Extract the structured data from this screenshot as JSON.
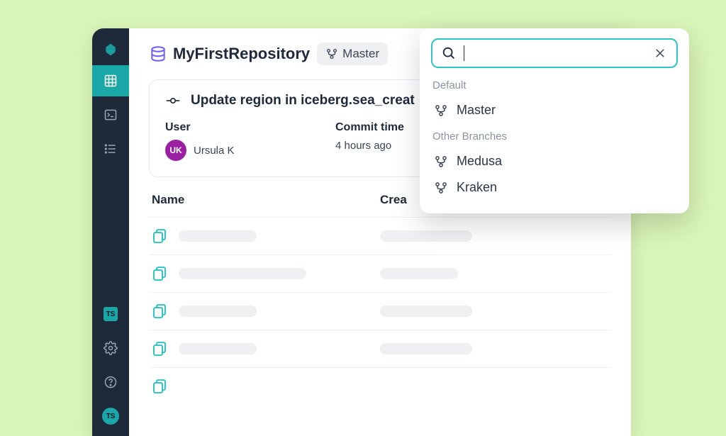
{
  "repo": {
    "name": "MyFirstRepository",
    "current_branch": "Master"
  },
  "commit": {
    "title": "Update region in iceberg.sea_creat",
    "user_label": "User",
    "user_initials": "UK",
    "user_name": "Ursula K",
    "time_label": "Commit time",
    "time_value": "4 hours ago"
  },
  "table": {
    "col_name": "Name",
    "col_created": "Crea"
  },
  "branch_picker": {
    "search_placeholder": "",
    "section_default": "Default",
    "section_other": "Other Branches",
    "default_branch": "Master",
    "other_branches": [
      "Medusa",
      "Kraken"
    ]
  },
  "sidebar": {
    "badge": "TS",
    "avatar": "TS"
  }
}
